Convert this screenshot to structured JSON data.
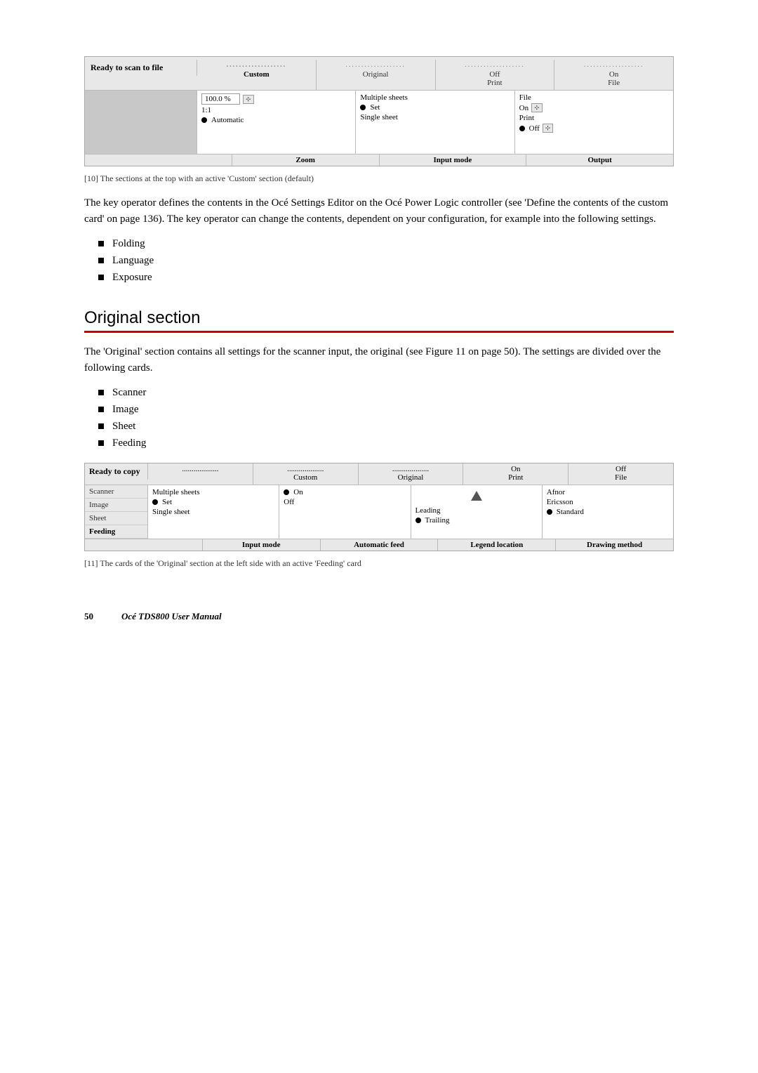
{
  "page": {
    "number": "50",
    "manual_title": "Océ TDS800 User Manual"
  },
  "figure10": {
    "header_label": "Ready to scan to file",
    "tabs": [
      {
        "dots": "...................",
        "label": "Custom",
        "active": true
      },
      {
        "dots": "...................",
        "label": "Original"
      },
      {
        "dots": "...................",
        "sub1": "Off",
        "sub2": "Print",
        "label": ""
      },
      {
        "dots": "...................",
        "sub1": "On",
        "sub2": "File",
        "label": ""
      }
    ],
    "zoom_panel": {
      "input_val": "100.0 %",
      "row1": "1:1",
      "row2": "● Automatic",
      "label": "Zoom"
    },
    "input_mode_panel": {
      "row1": "Multiple sheets",
      "row2": "● Set",
      "row3": "Single sheet",
      "label": "Input mode"
    },
    "output_panel": {
      "row1": "File",
      "row2": "On",
      "row3": "Print",
      "row4": "● Off",
      "label": "Output"
    }
  },
  "figure10_caption": "[10] The sections at the top with an active 'Custom' section (default)",
  "body_text1": "The key operator defines the contents in the Océ Settings Editor on the Océ Power Logic controller (see 'Define the contents of the custom card' on page 136). The key operator can change the contents, dependent on your configuration, for example into the following settings.",
  "bullets_custom": [
    "Folding",
    "Language",
    "Exposure"
  ],
  "section_heading": "Original section",
  "body_text2": "The 'Original' section contains all settings for the scanner input, the original (see Figure 11 on page 50). The settings are divided over the following cards.",
  "bullets_original": [
    "Scanner",
    "Image",
    "Sheet",
    "Feeding"
  ],
  "figure11": {
    "header_label": "Ready to copy",
    "tabs": [
      {
        "dots": "...................",
        "label": ""
      },
      {
        "dots": "...................",
        "label": "Custom"
      },
      {
        "dots": "...................",
        "label": "Original"
      },
      {
        "sub1": "On",
        "sub2": "Print",
        "dots": "...................",
        "label": ""
      },
      {
        "sub1": "Off",
        "sub2": "File",
        "dots": "...................",
        "label": ""
      }
    ],
    "sidebar_items": [
      {
        "label": "Scanner",
        "active": false
      },
      {
        "label": "Image",
        "active": false
      },
      {
        "label": "Sheet",
        "active": false
      },
      {
        "label": "Feeding",
        "active": true
      }
    ],
    "input_mode_panel": {
      "row1": "Multiple sheets",
      "row2": "● Set",
      "row3": "Single sheet",
      "label": "Input mode"
    },
    "auto_feed_panel": {
      "row1": "● On",
      "row2": "Off",
      "label": "Automatic feed"
    },
    "legend_panel": {
      "arrow": true,
      "row1": "Leading",
      "row2": "● Trailing",
      "label": "Legend location"
    },
    "drawing_method_panel": {
      "row1": "Afnor",
      "row2": "Ericsson",
      "row3": "● Standard",
      "label": "Drawing method"
    }
  },
  "figure11_caption": "[11] The cards of the 'Original' section at the left side with an active 'Feeding' card"
}
